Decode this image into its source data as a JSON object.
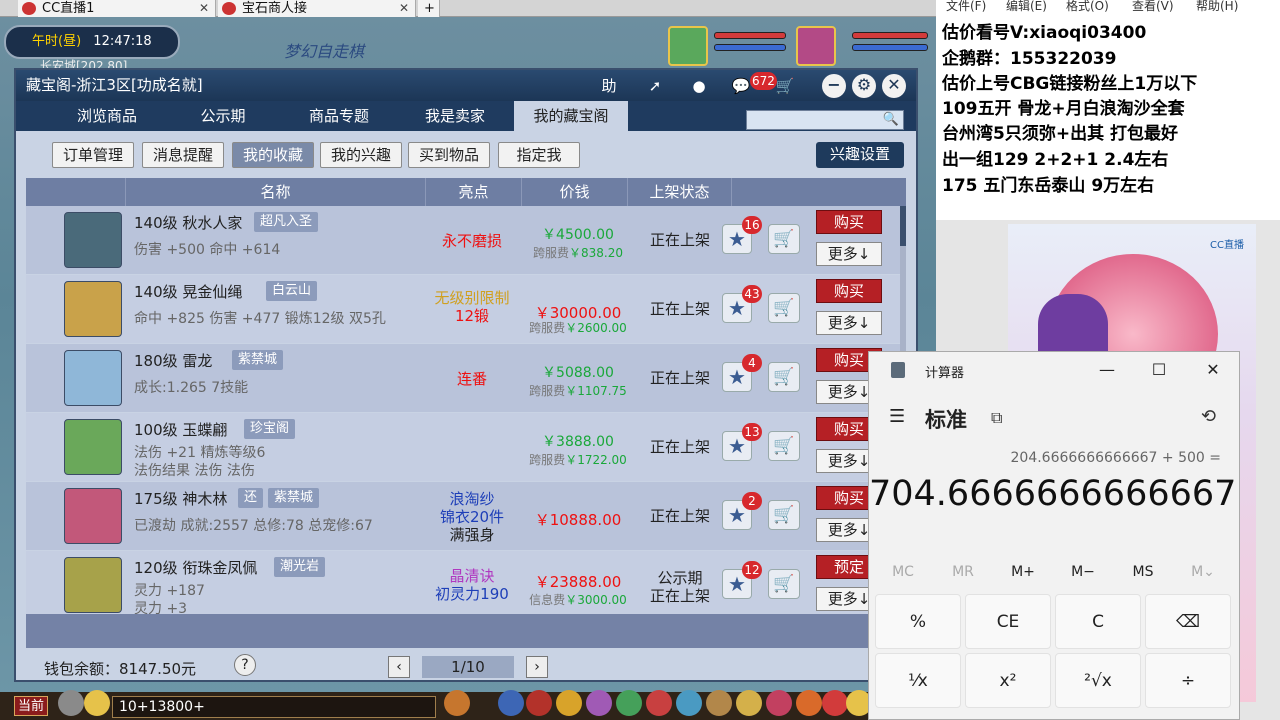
{
  "browser_tabs": [
    {
      "label": "CC直播1"
    },
    {
      "label": "宝石商人接"
    }
  ],
  "game": {
    "time_label": "午时(昼)",
    "clock": "12:47:18",
    "map_name": "长安城[202,80]",
    "banner": "梦幻自走棋"
  },
  "dialog": {
    "title": "藏宝阁-浙江3区[功成名就]",
    "title_icons": {
      "help": "助",
      "share": "share-icon",
      "record": "record-icon",
      "chat_badge": "672"
    },
    "nav_tabs": [
      {
        "label": "浏览商品"
      },
      {
        "label": "公示期"
      },
      {
        "label": "商品专题"
      },
      {
        "label": "我是卖家"
      },
      {
        "label": "我的藏宝阁"
      }
    ],
    "sub_tabs": [
      {
        "label": "订单管理"
      },
      {
        "label": "消息提醒"
      },
      {
        "label": "我的收藏"
      },
      {
        "label": "我的兴趣"
      },
      {
        "label": "买到物品"
      },
      {
        "label": "指定我"
      }
    ],
    "interest_settings": "兴趣设置",
    "columns": {
      "name": "名称",
      "highlight": "亮点",
      "price": "价钱",
      "status": "上架状态"
    },
    "rows": [
      {
        "name": "140级 秋水人家",
        "tag": "超凡入圣",
        "desc1": "伤害 +500 命中 +614",
        "desc2": "",
        "hl1": "永不磨损",
        "hl2": "",
        "hl3": "",
        "price": "￥4500.00",
        "fee_label": "跨服费",
        "fee": "￥838.20",
        "status1": "正在上架",
        "status2": "",
        "favs": "16",
        "action": "购买",
        "more": "更多↓"
      },
      {
        "name": "140级 晃金仙绳",
        "tag": "白云山",
        "desc1": "命中 +825 伤害 +477 锻炼12级 双5孔",
        "desc2": "",
        "hl1": "无级别限制",
        "hl2": "12锻",
        "hl3": "",
        "price": "￥30000.00",
        "fee_label": "跨服费",
        "fee": "￥2600.00",
        "status1": "正在上架",
        "status2": "",
        "favs": "43",
        "action": "购买",
        "more": "更多↓"
      },
      {
        "name": "180级 雷龙",
        "tag": "紫禁城",
        "desc1": "成长:1.265 7技能",
        "desc2": "",
        "hl1": "连番",
        "hl2": "",
        "hl3": "",
        "price": "￥5088.00",
        "fee_label": "跨服费",
        "fee": "￥1107.75",
        "status1": "正在上架",
        "status2": "",
        "favs": "4",
        "action": "购买",
        "more": "更多↓"
      },
      {
        "name": "100级 玉蝶翩",
        "tag": "珍宝阁",
        "desc1": "法伤 +21 精炼等级6",
        "desc2": "法伤结果 法伤 法伤",
        "hl1": "",
        "hl2": "",
        "hl3": "",
        "price": "￥3888.00",
        "fee_label": "跨服费",
        "fee": "￥1722.00",
        "status1": "正在上架",
        "status2": "",
        "favs": "13",
        "action": "购买",
        "more": "更多↓"
      },
      {
        "name": "175级 神木林",
        "tag2": "还",
        "tag": "紫禁城",
        "desc1": "已渡劫 成就:2557 总修:78 总宠修:67",
        "desc2": "",
        "hl1": "浪淘纱",
        "hl2": "锦衣20件",
        "hl3": "满强身",
        "price": "￥10888.00",
        "fee_label": "",
        "fee": "",
        "status1": "正在上架",
        "status2": "",
        "favs": "2",
        "action": "购买",
        "more": "更多↓"
      },
      {
        "name": "120级 衔珠金凤佩",
        "tag": "潮光岩",
        "desc1": "灵力 +187",
        "desc2": "灵力 +3",
        "hl1": "晶清诀",
        "hl2": "初灵力190",
        "hl3": "",
        "price": "￥23888.00",
        "fee_label": "信息费",
        "fee": "￥3000.00",
        "status1": "公示期",
        "status2": "正在上架",
        "favs": "12",
        "action": "预定",
        "more": "更多↓"
      }
    ],
    "wallet": "钱包余额：8147.50元",
    "page": "1/10"
  },
  "bottom": {
    "current_channel": "当前",
    "chat_text": "10+13800+"
  },
  "notepad": {
    "menu": [
      "文件(F)",
      "编辑(E)",
      "格式(O)",
      "查看(V)",
      "帮助(H)"
    ],
    "lines": [
      "估价看号V:xiaoqi03400",
      "企鹅群：155322039",
      "估价上号CBG链接粉丝上1万以下",
      "109五开 骨龙+月白浪淘沙全套",
      "台州湾5只须弥+出其 打包最好",
      "出一组129 2+2+1   2.4左右",
      "175 五门东岳泰山  9万左右"
    ]
  },
  "promo": {
    "logo": "CC直播"
  },
  "calculator": {
    "title": "计算器",
    "mode": "标准",
    "expression": "204.6666666666667 + 500 =",
    "result": "704.6666666666667",
    "memory": [
      "MC",
      "MR",
      "M+",
      "M−",
      "MS",
      "M⌄"
    ],
    "keys_row1": [
      "%",
      "CE",
      "C",
      "⌫"
    ],
    "keys_row2": [
      "¹⁄x",
      "x²",
      "²√x",
      "÷"
    ]
  }
}
